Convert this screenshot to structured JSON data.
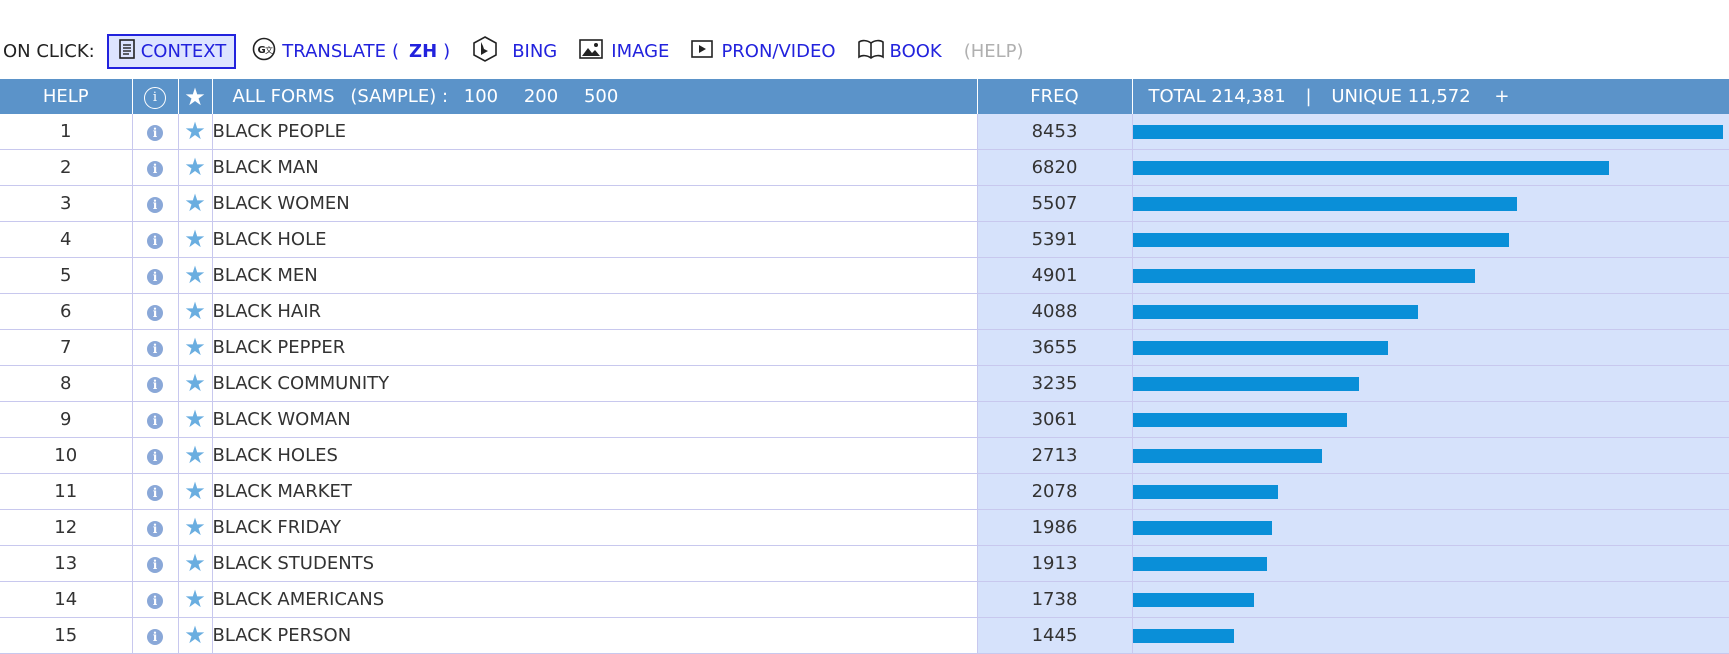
{
  "toolbar": {
    "on_click_label": "ON CLICK:",
    "items": [
      {
        "label": "CONTEXT",
        "icon": "document-icon",
        "active": true
      },
      {
        "label": "TRANSLATE",
        "icon": "translate-icon",
        "lang": "ZH",
        "open_paren": "(",
        "close_paren": ")"
      },
      {
        "label": "BING",
        "icon": "bing-icon"
      },
      {
        "label": "IMAGE",
        "icon": "image-icon"
      },
      {
        "label": "PRON/VIDEO",
        "icon": "video-icon"
      },
      {
        "label": "BOOK",
        "icon": "book-icon"
      }
    ],
    "help_label": "(HELP)"
  },
  "table": {
    "headers": {
      "help": "HELP",
      "info_icon": "info-icon",
      "star_icon": "star-icon",
      "all_forms": "ALL FORMS",
      "sample_label": "(SAMPLE) :",
      "sample_options": [
        "100",
        "200",
        "500"
      ],
      "freq": "FREQ",
      "total_label": "TOTAL 214,381",
      "separator": "|",
      "unique_label": "UNIQUE 11,572",
      "plus": "+"
    },
    "max_freq": 8453,
    "rows": [
      {
        "rank": "1",
        "word": "BLACK PEOPLE",
        "freq": 8453
      },
      {
        "rank": "2",
        "word": "BLACK MAN",
        "freq": 6820
      },
      {
        "rank": "3",
        "word": "BLACK WOMEN",
        "freq": 5507
      },
      {
        "rank": "4",
        "word": "BLACK HOLE",
        "freq": 5391
      },
      {
        "rank": "5",
        "word": "BLACK MEN",
        "freq": 4901
      },
      {
        "rank": "6",
        "word": "BLACK HAIR",
        "freq": 4088
      },
      {
        "rank": "7",
        "word": "BLACK PEPPER",
        "freq": 3655
      },
      {
        "rank": "8",
        "word": "BLACK COMMUNITY",
        "freq": 3235
      },
      {
        "rank": "9",
        "word": "BLACK WOMAN",
        "freq": 3061
      },
      {
        "rank": "10",
        "word": "BLACK HOLES",
        "freq": 2713
      },
      {
        "rank": "11",
        "word": "BLACK MARKET",
        "freq": 2078
      },
      {
        "rank": "12",
        "word": "BLACK FRIDAY",
        "freq": 1986
      },
      {
        "rank": "13",
        "word": "BLACK STUDENTS",
        "freq": 1913
      },
      {
        "rank": "14",
        "word": "BLACK AMERICANS",
        "freq": 1738
      },
      {
        "rank": "15",
        "word": "BLACK PERSON",
        "freq": 1445
      }
    ]
  },
  "colors": {
    "link": "#2222dd",
    "header_bg": "#5b93c9",
    "freq_bg": "#d6e2fb",
    "bar": "#0a8fd8",
    "star": "#6aaee0"
  }
}
